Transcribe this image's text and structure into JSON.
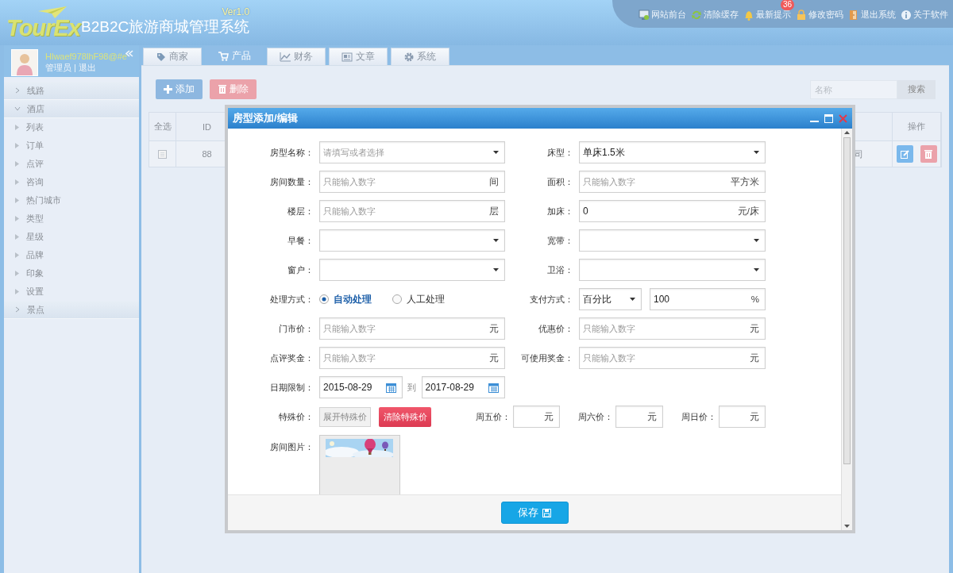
{
  "header": {
    "logo": "TourEx",
    "version": "Ver1.0",
    "title": "B2B2C旅游商城管理系统"
  },
  "top_links": [
    {
      "kind": "monitor",
      "label": "网站前台"
    },
    {
      "kind": "refresh",
      "label": "清除缓存"
    },
    {
      "kind": "bell",
      "label": "最新提示",
      "badge": "36"
    },
    {
      "kind": "lock",
      "label": "修改密码"
    },
    {
      "kind": "door",
      "label": "退出系统"
    },
    {
      "kind": "info",
      "label": "关于软件"
    }
  ],
  "user": {
    "name": "Hlwaef978lhF98@#e",
    "role": "管理员",
    "separator": "|",
    "logout": "退出"
  },
  "sidebar": {
    "items": [
      {
        "label": "线路",
        "expanded": false
      },
      {
        "label": "酒店",
        "expanded": true,
        "children": [
          {
            "label": "列表"
          },
          {
            "label": "订单"
          },
          {
            "label": "点评"
          },
          {
            "label": "咨询"
          },
          {
            "label": "热门城市"
          },
          {
            "label": "类型"
          },
          {
            "label": "星级"
          },
          {
            "label": "品牌"
          },
          {
            "label": "印象"
          },
          {
            "label": "设置"
          }
        ]
      },
      {
        "label": "景点",
        "expanded": false
      }
    ]
  },
  "tabs": [
    {
      "kind": "tag",
      "label": "商家",
      "selected": false
    },
    {
      "kind": "cart",
      "label": "产品",
      "selected": true
    },
    {
      "kind": "chart",
      "label": "财务",
      "selected": false
    },
    {
      "kind": "article",
      "label": "文章",
      "selected": false
    },
    {
      "kind": "gear",
      "label": "系统",
      "selected": false
    }
  ],
  "toolbar": {
    "buttons": [
      {
        "kind": "add",
        "label": "添加"
      },
      {
        "kind": "delete",
        "label": "删除"
      }
    ],
    "search": {
      "placeholder": "名称",
      "button": "搜索"
    }
  },
  "table": {
    "columns": [
      {
        "label": "全选"
      },
      {
        "label": "ID"
      },
      {
        "label": "操作"
      }
    ],
    "rows": [
      {
        "checked": false,
        "id": "88",
        "column_3": "司"
      }
    ]
  },
  "dialog": {
    "title": "房型添加/编辑",
    "save": "保存",
    "rows": [
      [
        {
          "kind": "select",
          "label": "房型名称：",
          "placeholder": "请填写或者选择"
        },
        {
          "kind": "select",
          "label": "床型：",
          "value": "单床1.5米"
        }
      ],
      [
        {
          "kind": "input",
          "label": "房间数量：",
          "placeholder": "只能输入数字",
          "unit": "间"
        },
        {
          "kind": "input",
          "label": "面积：",
          "placeholder": "只能输入数字",
          "unit": "平方米"
        }
      ],
      [
        {
          "kind": "input",
          "label": "楼层：",
          "placeholder": "只能输入数字",
          "unit": "层"
        },
        {
          "kind": "input",
          "label": "加床：",
          "value": "0",
          "unit": "元/床"
        }
      ],
      [
        {
          "kind": "select",
          "label": "早餐："
        },
        {
          "kind": "select",
          "label": "宽带："
        }
      ],
      [
        {
          "kind": "select",
          "label": "窗户："
        },
        {
          "kind": "select",
          "label": "卫浴："
        }
      ],
      [
        {
          "kind": "radio",
          "label": "处理方式：",
          "options": [
            {
              "label": "自动处理",
              "selected": true
            },
            {
              "label": "人工处理",
              "selected": false
            }
          ]
        },
        {
          "kind": "payment",
          "label": "支付方式：",
          "select": "百分比",
          "value": "100",
          "unit": "%"
        }
      ],
      [
        {
          "kind": "input",
          "label": "门市价：",
          "placeholder": "只能输入数字",
          "unit": "元"
        },
        {
          "kind": "input",
          "label": "优惠价：",
          "placeholder": "只能输入数字",
          "unit": "元"
        }
      ],
      [
        {
          "kind": "input",
          "label": "点评奖金：",
          "placeholder": "只能输入数字",
          "unit": "元"
        },
        {
          "kind": "input",
          "label": "可使用奖金：",
          "placeholder": "只能输入数字",
          "unit": "元"
        }
      ],
      [
        {
          "kind": "date-range",
          "label": "日期限制：",
          "from": "2015-08-29",
          "joiner": "到",
          "to": "2017-08-29"
        }
      ],
      [
        {
          "kind": "special-price",
          "label": "特殊价：",
          "expand": "展开特殊价",
          "clear": "清除特殊价",
          "days": [
            {
              "label": "周五价：",
              "unit": "元"
            },
            {
              "label": "周六价：",
              "unit": "元"
            },
            {
              "label": "周日价：",
              "unit": "元"
            }
          ]
        }
      ],
      [
        {
          "label": "房间图片："
        }
      ]
    ]
  }
}
